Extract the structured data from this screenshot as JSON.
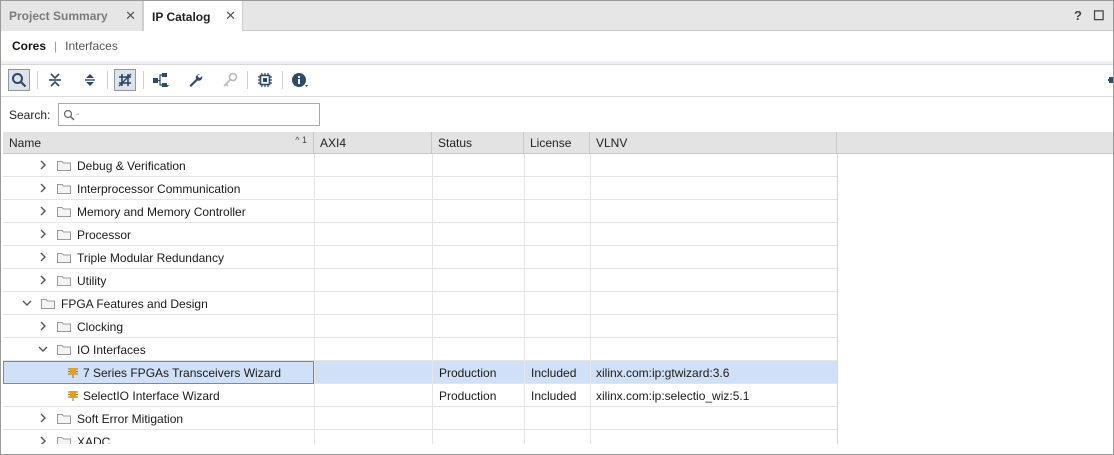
{
  "tabs": [
    {
      "label": "Project Summary",
      "active": false
    },
    {
      "label": "IP Catalog",
      "active": true
    }
  ],
  "window_controls": {
    "help": "?",
    "restore": "☐"
  },
  "subtabs": {
    "active": "Cores",
    "separator": "|",
    "inactive": "Interfaces"
  },
  "search": {
    "label": "Search:",
    "placeholder": "Q-",
    "value": ""
  },
  "columns": [
    "Name",
    "AXI4",
    "Status",
    "License",
    "VLNV"
  ],
  "sort_indicator": "^ 1",
  "rows": [
    {
      "name": "Debug & Verification",
      "type": "folder",
      "expanded": false,
      "axi4": "",
      "status": "",
      "license": "",
      "vlnv": ""
    },
    {
      "name": "Interprocessor Communication",
      "type": "folder",
      "expanded": false,
      "axi4": "",
      "status": "",
      "license": "",
      "vlnv": ""
    },
    {
      "name": "Memory and Memory Controller",
      "type": "folder",
      "expanded": false,
      "axi4": "",
      "status": "",
      "license": "",
      "vlnv": ""
    },
    {
      "name": "Processor",
      "type": "folder",
      "expanded": false,
      "axi4": "",
      "status": "",
      "license": "",
      "vlnv": ""
    },
    {
      "name": "Triple Modular Redundancy",
      "type": "folder",
      "expanded": false,
      "axi4": "",
      "status": "",
      "license": "",
      "vlnv": ""
    },
    {
      "name": "Utility",
      "type": "folder",
      "expanded": false,
      "axi4": "",
      "status": "",
      "license": "",
      "vlnv": ""
    },
    {
      "name": "FPGA Features and Design",
      "type": "folder",
      "expanded": true,
      "axi4": "",
      "status": "",
      "license": "",
      "vlnv": ""
    },
    {
      "name": "Clocking",
      "type": "folder",
      "expanded": false,
      "axi4": "",
      "status": "",
      "license": "",
      "vlnv": ""
    },
    {
      "name": "IO Interfaces",
      "type": "folder",
      "expanded": true,
      "axi4": "",
      "status": "",
      "license": "",
      "vlnv": ""
    },
    {
      "name": "7 Series FPGAs Transceivers Wizard",
      "type": "ip",
      "selected": true,
      "axi4": "",
      "status": "Production",
      "license": "Included",
      "vlnv": "xilinx.com:ip:gtwizard:3.6"
    },
    {
      "name": "SelectIO Interface Wizard",
      "type": "ip",
      "selected": false,
      "axi4": "",
      "status": "Production",
      "license": "Included",
      "vlnv": "xilinx.com:ip:selectio_wiz:5.1"
    },
    {
      "name": "Soft Error Mitigation",
      "type": "folder",
      "expanded": false,
      "axi4": "",
      "status": "",
      "license": "",
      "vlnv": ""
    },
    {
      "name": "XADC",
      "type": "folder",
      "expanded": false,
      "axi4": "",
      "status": "",
      "license": "",
      "vlnv": ""
    }
  ],
  "colors": {
    "selected_row": "#cfe0f7",
    "selection_border": "#5a8fd6",
    "toolbar_icon": "#2c4a6b",
    "ip_icon": "#e0a020"
  }
}
